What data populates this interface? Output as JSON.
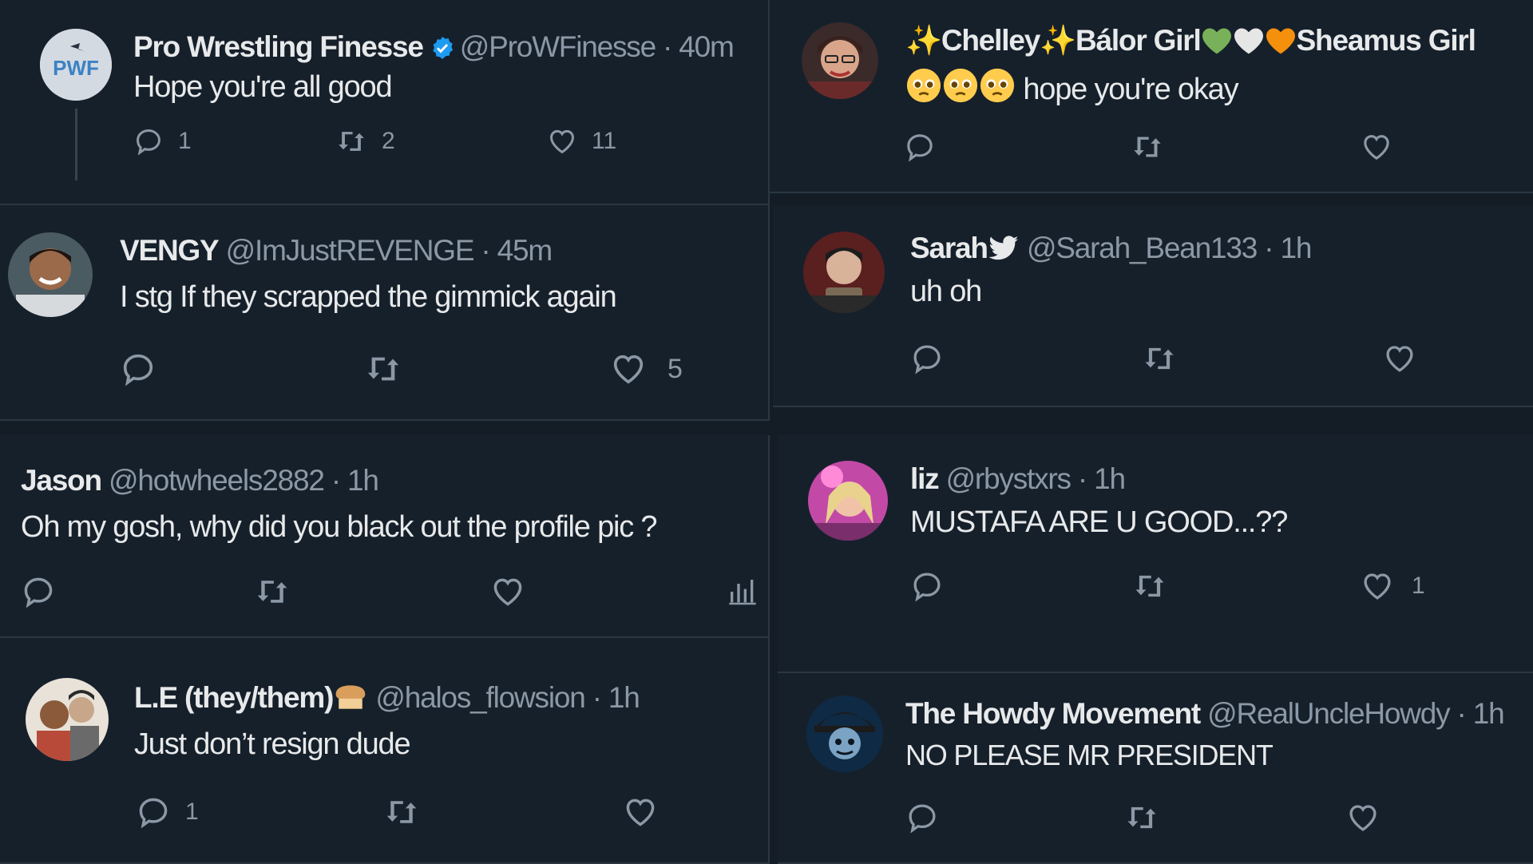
{
  "tweets": [
    {
      "name": "Pro Wrestling Finesse",
      "handle": "@ProWFinesse",
      "sep": "·",
      "time": "40m",
      "text": "Hope you're all good",
      "reply": "1",
      "retweet": "2",
      "like": "11",
      "avatar_label": "PWF",
      "verified": true
    },
    {
      "name": "✨Chelley✨Bálor Girl",
      "name_part2": "Sheamus Girl",
      "handle": "",
      "sep": "",
      "time": "",
      "text": "hope you're okay",
      "reply": "",
      "retweet": "",
      "like": ""
    },
    {
      "name": "VENGY",
      "handle": "@ImJustREVENGE",
      "sep": "·",
      "time": "45m",
      "text": "I stg If they scrapped the gimmick again",
      "reply": "",
      "retweet": "",
      "like": "5"
    },
    {
      "name": "Sarah",
      "handle": "@Sarah_Bean133",
      "sep": "·",
      "time": "1h",
      "text": "uh oh",
      "reply": "",
      "retweet": "",
      "like": ""
    },
    {
      "name": "Jason",
      "handle": "@hotwheels2882",
      "sep": "·",
      "time": "1h",
      "text": "Oh my gosh, why did you black out the profile pic ?",
      "reply": "",
      "retweet": "",
      "like": ""
    },
    {
      "name": "liz",
      "handle": "@rbystxrs",
      "sep": "·",
      "time": "1h",
      "text": "MUSTAFA ARE U GOOD...??",
      "reply": "",
      "retweet": "",
      "like": "1"
    },
    {
      "name": "L.E (they/them)",
      "handle": "@halos_flowsion",
      "sep": "·",
      "time": "1h",
      "text": "Just don’t resign dude",
      "reply": "1",
      "retweet": "",
      "like": ""
    },
    {
      "name": "The Howdy Movement",
      "handle": "@RealUncleHowdy",
      "sep": "·",
      "time": "1h",
      "text": "NO PLEASE MR PRESIDENT",
      "reply": "",
      "retweet": "",
      "like": ""
    }
  ],
  "icons": {
    "reply": "reply-icon",
    "retweet": "retweet-icon",
    "like": "heart-icon",
    "views": "views-icon",
    "verified": "verified-badge-icon",
    "bird": "bird-icon"
  },
  "colors": {
    "background": "#16202b",
    "text": "#e7e9ea",
    "muted": "#8b98a5",
    "verified": "#1d9bf0",
    "divider": "#2a3743"
  }
}
